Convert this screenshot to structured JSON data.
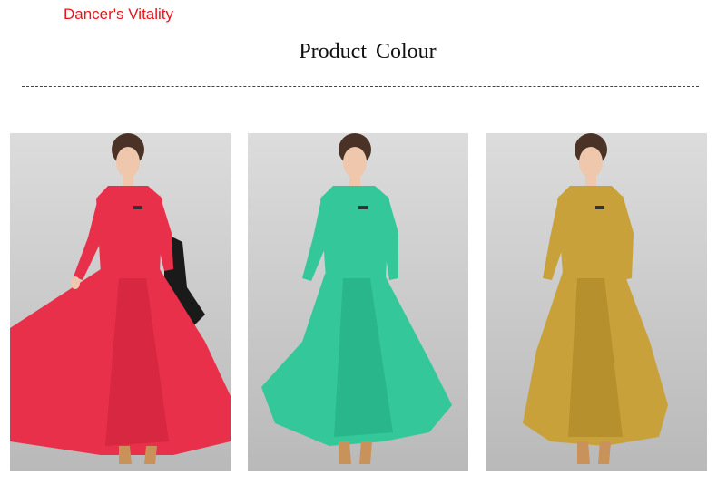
{
  "header": {
    "brand": "Dancer's Vitality",
    "title": "Product Colour"
  },
  "products": [
    {
      "dress_color": "#e8304a",
      "dress_shade": "#c81e36"
    },
    {
      "dress_color": "#34c79a",
      "dress_shade": "#1fa67c"
    },
    {
      "dress_color": "#c9a13a",
      "dress_shade": "#a67f22"
    }
  ]
}
